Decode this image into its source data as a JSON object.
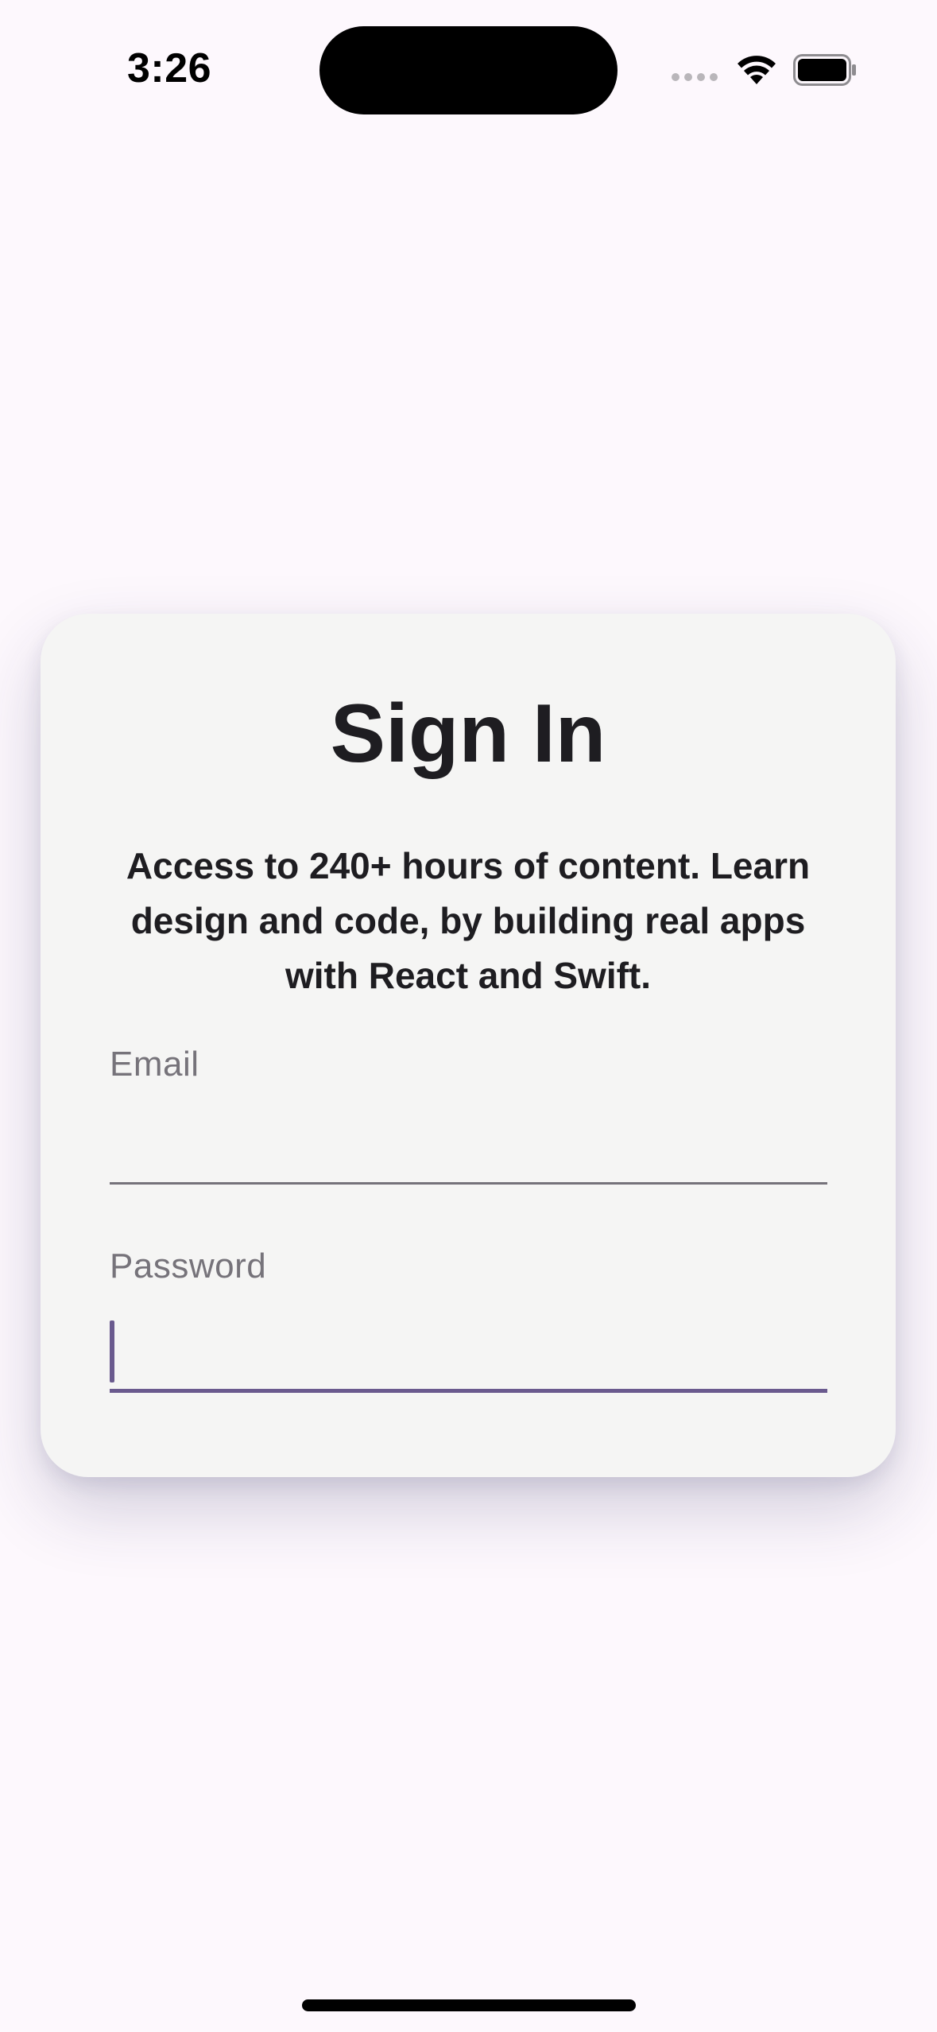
{
  "status_bar": {
    "time": "3:26"
  },
  "card": {
    "title": "Sign In",
    "subtitle": "Access to 240+ hours of content. Learn design and code, by building real apps with React and Swift.",
    "email": {
      "label": "Email",
      "value": ""
    },
    "password": {
      "label": "Password",
      "value": ""
    }
  },
  "colors": {
    "background": "#fdf8fd",
    "card": "#f5f5f4",
    "text": "#1e1d21",
    "label": "#76737a",
    "accent": "#6a5a8e"
  }
}
